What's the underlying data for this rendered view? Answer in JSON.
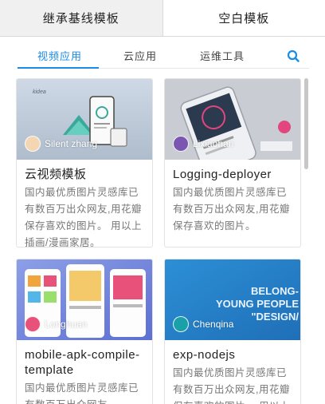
{
  "top_tabs": [
    {
      "label": "继承基线模板"
    },
    {
      "label": "空白模板"
    }
  ],
  "sub_tabs": [
    {
      "label": "视频应用"
    },
    {
      "label": "云应用"
    },
    {
      "label": "运维工具"
    }
  ],
  "accent_color": "#1a8be6",
  "cards": [
    {
      "title": "云视频模板",
      "author": "Silent zhang",
      "description": "国内最优质图片灵感库已有数百万出众网友,用花瓣保存喜欢的图片。 用以上插画/漫画家居。"
    },
    {
      "title": "Logging-deployer",
      "author": "Lixiaohan",
      "description": "国内最优质图片灵感库已有数百万出众网友,用花瓣保存喜欢的图片。"
    },
    {
      "title": "mobile-apk-compile-template",
      "author": "Longhuan",
      "description": "国内最优质图片灵感库已有数百万出众网友。"
    },
    {
      "title": "exp-nodejs",
      "author": "Chenqina",
      "description": "国内最优质图片灵感库已有数百万出众网友,用花瓣保存喜欢的图片。 用以上"
    }
  ],
  "thumbnail_text": {
    "kidea": "kidea",
    "belong_1": "BELONG-",
    "belong_2": "YOUNG PEOPLE",
    "belong_3": "\"DESIGN/"
  }
}
